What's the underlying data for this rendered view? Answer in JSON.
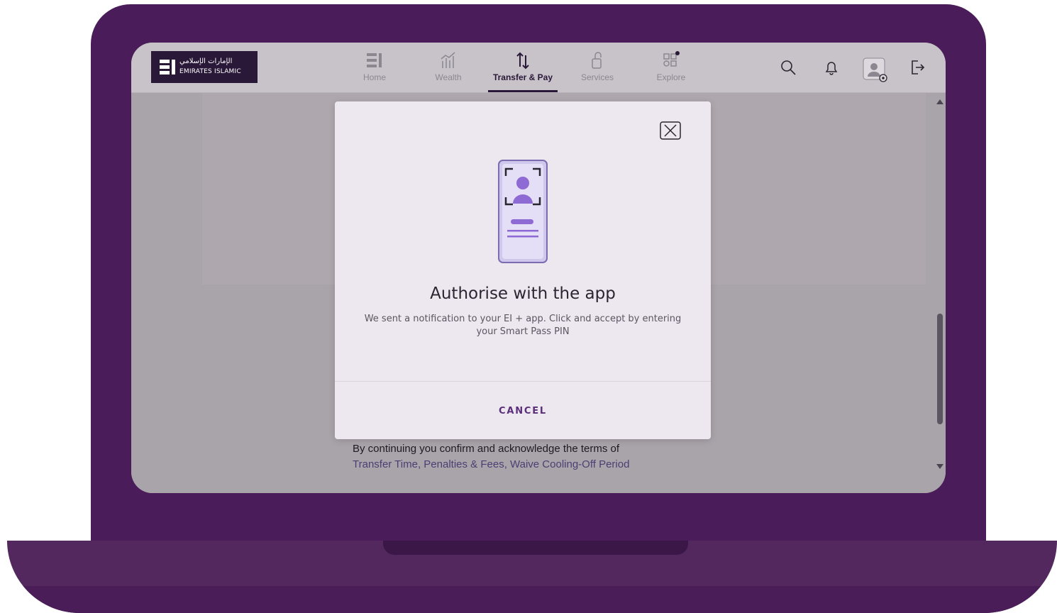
{
  "brand": {
    "arabic_name": "الإمارات الإسلامي",
    "english_name": "EMIRATES ISLAMIC"
  },
  "nav": {
    "items": [
      {
        "label": "Home",
        "icon": "home-icon"
      },
      {
        "label": "Wealth",
        "icon": "wealth-chart-icon"
      },
      {
        "label": "Transfer & Pay",
        "icon": "transfer-arrows-icon",
        "active": true
      },
      {
        "label": "Services",
        "icon": "services-icon"
      },
      {
        "label": "Explore",
        "icon": "explore-grid-icon"
      }
    ],
    "right_icons": [
      "search-icon",
      "bell-icon",
      "profile-settings-icon",
      "logout-icon"
    ]
  },
  "modal": {
    "title": "Authorise with the app",
    "description": "We sent a notification to your EI + app. Click and accept by entering your Smart Pass PIN",
    "cancel_label": "CANCEL",
    "illustration": "phone-face-id-icon"
  },
  "terms": {
    "text": "By continuing you confirm and acknowledge the terms of",
    "links": "Transfer Time, Penalties & Fees, Waive Cooling-Off Period"
  },
  "colors": {
    "frame": "#4a1d5a",
    "accent": "#5a2e78",
    "logo_bg": "#2a1838"
  }
}
